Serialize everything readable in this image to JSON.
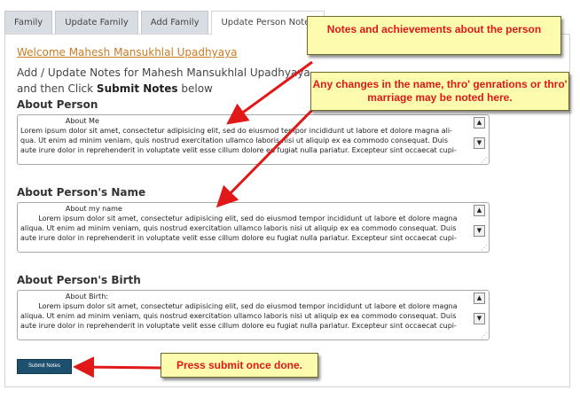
{
  "tabs": [
    "Family",
    "Update Family",
    "Add Family",
    "Update Person Notes"
  ],
  "active_tab": 3,
  "welcome_link": "Welcome Mahesh Mansukhlal Upadhyaya",
  "intro": {
    "line1": "Add / Update Notes for Mahesh Mansukhlal Upadhyaya",
    "line2_prefix": "and then Click ",
    "line2_bold": "Submit Notes",
    "line2_suffix": " below"
  },
  "sections": [
    {
      "title": "About Person",
      "text": "                    About Me\nLorem ipsum dolor sit amet, consectetur adipisicing elit, sed do eiusmod tempor incididunt ut labore et dolore magna ali-\nqua. Ut enim ad minim veniam, quis nostrud exercitation ullamco laboris nisi ut aliquip ex ea commodo consequat. Duis\naute irure dolor in reprehenderit in voluptate velit esse cillum dolore eu fugiat nulla pariatur. Excepteur sint occaecat cupi-"
    },
    {
      "title": "About Person's Name",
      "text": "                    About my name\n        Lorem ipsum dolor sit amet, consectetur adipisicing elit, sed do eiusmod tempor incididunt ut labore et dolore magna\naliqua. Ut enim ad minim veniam, quis nostrud exercitation ullamco laboris nisi ut aliquip ex ea commodo consequat. Duis\naute irure dolor in reprehenderit in voluptate velit esse cillum dolore eu fugiat nulla pariatur. Excepteur sint occaecat cupi-"
    },
    {
      "title": "About Person's Birth",
      "text": "                    About Birth:\n        Lorem ipsum dolor sit amet, consectetur adipisicing elit, sed do eiusmod tempor incididunt ut labore et dolore magna\naliqua. Ut enim ad minim veniam, quis nostrud exercitation ullamco laboris nisi ut aliquip ex ea commodo consequat. Duis\naute irure dolor in reprehenderit in voluptate velit esse cillum dolore eu fugiat nulla pariatur. Excepteur sint occaecat cupi-"
    }
  ],
  "submit_label": "Submit Notes",
  "callouts": [
    "Notes and achievements about the person",
    "Any changes in the name, thro' genrations or thro' marriage may be noted here.",
    "Press submit once done."
  ],
  "icons": {
    "scroll_up": "triangle-up-icon",
    "scroll_down": "triangle-down-icon",
    "resize": "resize-grip-icon"
  },
  "colors": {
    "callout_bg": "#fdfcae",
    "callout_text": "#e01818",
    "arrow": "#e01818",
    "submit_bg": "#1d4f6e",
    "link": "#c97c24"
  }
}
